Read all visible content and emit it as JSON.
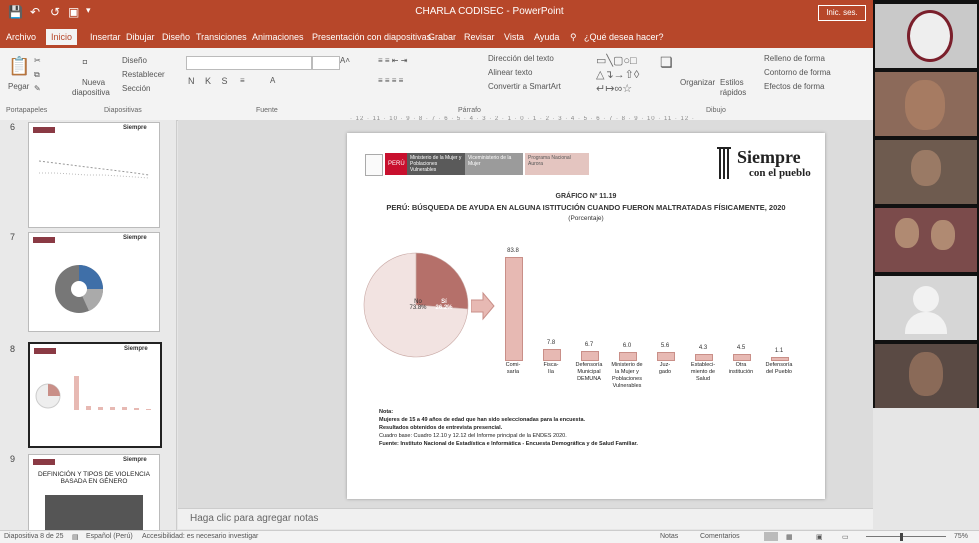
{
  "window": {
    "title": "CHARLA CODISEC - PowerPoint",
    "signin_label": "Inic. ses.",
    "accent": "#b7472a"
  },
  "ribbon_tabs": [
    {
      "label": "Archivo",
      "active": false
    },
    {
      "label": "Inicio",
      "active": true
    },
    {
      "label": "Insertar",
      "active": false
    },
    {
      "label": "Dibujar",
      "active": false
    },
    {
      "label": "Diseño",
      "active": false
    },
    {
      "label": "Transiciones",
      "active": false
    },
    {
      "label": "Animaciones",
      "active": false
    },
    {
      "label": "Presentación con diapositivas",
      "active": false
    },
    {
      "label": "Grabar",
      "active": false
    },
    {
      "label": "Revisar",
      "active": false
    },
    {
      "label": "Vista",
      "active": false
    },
    {
      "label": "Ayuda",
      "active": false
    }
  ],
  "tell_me": "¿Qué desea hacer?",
  "ribbon": {
    "paste": "Pegar",
    "new_slide_1": "Nueva",
    "new_slide_2": "diapositiva",
    "layout": "Diseño",
    "reset": "Restablecer",
    "section": "Sección",
    "font_format": "N K S",
    "text_direction": "Dirección del texto",
    "align_text": "Alinear texto",
    "smartart": "Convertir a SmartArt",
    "arrange": "Organizar",
    "quick_styles_1": "Estilos",
    "quick_styles_2": "rápidos",
    "shape_fill": "Relleno de forma",
    "shape_outline": "Contorno de forma",
    "shape_effects": "Efectos de forma",
    "group_labels": [
      "Portapapeles",
      "Diapositivas",
      "Fuente",
      "Párrafo",
      "Dibujo"
    ]
  },
  "thumbnails": {
    "numbers": [
      "6",
      "7",
      "8",
      "9"
    ],
    "brand": "Siempre",
    "slide9_title": "DEFINICIÓN Y TIPOS DE VIOLENCIA BASADA EN GÉNERO"
  },
  "slide": {
    "gov_labels": [
      "PERÚ",
      "Ministerio de la Mujer y Poblaciones Vulnerables",
      "Viceministerio de la Mujer",
      "Programa Nacional Aurora"
    ],
    "brand_top": "Siempre",
    "brand_bottom": "con el pueblo",
    "chart_id": "GRÁFICO Nº 11.19",
    "chart_title": "PERÚ: BÚSQUEDA DE AYUDA EN ALGUNA ISTITUCIÓN CUANDO FUERON MALTRATADAS FÍSICAMENTE, 2020",
    "chart_unit": "(Porcentaje)",
    "notes": [
      "Nota:",
      "Mujeres de 15 a 49 años de edad que han sido seleccionadas para la encuesta.",
      "Resultados obtenidos de entrevista presencial.",
      "Cuadro base: Cuadro 12.10 y 12.12 del Informe principal de la ENDES 2020.",
      "Fuente: Instituto Nacional de Estadística e Informática - Encuesta Demográfica y de Salud Familiar."
    ]
  },
  "chart_data": {
    "type": "bar",
    "title": "PERÚ: BÚSQUEDA DE AYUDA EN ALGUNA ISTITUCIÓN CUANDO FUERON MALTRATADAS FÍSICAMENTE, 2020",
    "ylabel": "(Porcentaje)",
    "categories": [
      "Comisaría",
      "Fiscalía",
      "Defensoría Municipal DEMUNA",
      "Ministerio de la Mujer y Poblaciones Vulnerables",
      "Juzgado",
      "Establecimiento de Salud",
      "Otra institución",
      "Defensoría del Pueblo"
    ],
    "category_lines": [
      [
        "Comi-",
        "saría"
      ],
      [
        "Fisca-",
        "lía"
      ],
      [
        "Defensoría",
        "Municipal",
        "DEMUNA"
      ],
      [
        "Ministerio de",
        "la Mujer y",
        "Poblaciones",
        "Vulnerables"
      ],
      [
        "Juz-",
        "gado"
      ],
      [
        "Estableci-",
        "miento de",
        "Salud"
      ],
      [
        "Otra",
        "institución"
      ],
      [
        "Defensoría",
        "del Pueblo"
      ]
    ],
    "values": [
      83.8,
      7.8,
      6.7,
      6.0,
      5.6,
      4.3,
      4.5,
      1.1
    ],
    "value_labels": [
      "83.8",
      "7.8",
      "6.7",
      "6.0",
      "5.6",
      "4.3",
      "4.5",
      "1.1"
    ],
    "ylim": [
      0,
      90
    ],
    "pie": {
      "slices": [
        {
          "label": "No",
          "value": 73.8,
          "text": "73.8%",
          "color": "#f2e3e1"
        },
        {
          "label": "Sí",
          "value": 26.2,
          "text": "26.2%",
          "color": "#b5706a"
        }
      ]
    },
    "bar_color": "#e7b9b3"
  },
  "notes_pane": {
    "placeholder": "Haga clic para agregar notas"
  },
  "statusbar": {
    "slide_counter": "Diapositiva 8 de 25",
    "language": "Español (Perú)",
    "accessibility": "Accesibilidad: es necesario investigar",
    "notes_btn": "Notas",
    "comments_btn": "Comentarios",
    "zoom": "75%"
  }
}
